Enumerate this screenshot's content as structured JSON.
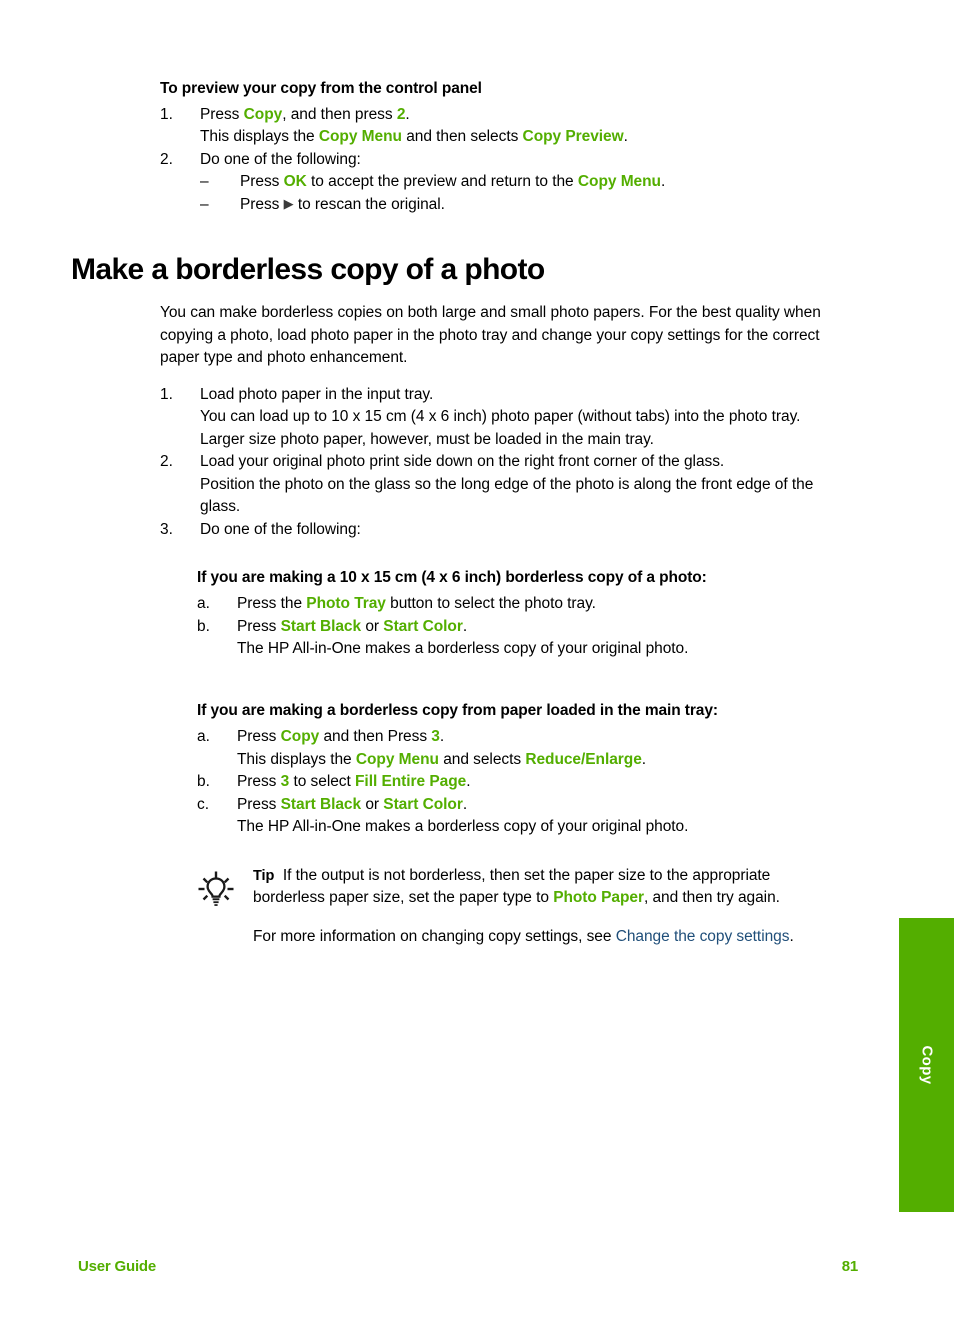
{
  "colors": {
    "accent_green": "#53ae00",
    "link_blue": "#1f4e79",
    "text_black": "#000000",
    "tab_white": "#ffffff"
  },
  "side_tab": {
    "label": "Copy"
  },
  "footer": {
    "left": "User Guide",
    "page_number": "81"
  },
  "preview_section": {
    "heading": "To preview your copy from the control panel",
    "step1": {
      "marker": "1.",
      "pre": "Press ",
      "b1": "Copy",
      "mid": ", and then press ",
      "b2": "2",
      "post": ".",
      "continuation": {
        "pre": "This displays the ",
        "b1": "Copy Menu",
        "mid": " and then selects ",
        "b2": "Copy Preview",
        "post": "."
      }
    },
    "step2": {
      "marker": "2.",
      "text": "Do one of the following:",
      "bullets": [
        {
          "marker": "–",
          "pre": "Press ",
          "b1": "OK",
          "mid": " to accept the preview and return to the ",
          "b2": "Copy Menu",
          "post": "."
        },
        {
          "marker": "–",
          "pre": "Press ",
          "icon": "▶",
          "post": " to rescan the original."
        }
      ]
    }
  },
  "main_section": {
    "title": "Make a borderless copy of a photo",
    "intro": "You can make borderless copies on both large and small photo papers. For the best quality when copying a photo, load photo paper in the photo tray and change your copy settings for the correct paper type and photo enhancement.",
    "steps": [
      {
        "marker": "1.",
        "text": "Load photo paper in the input tray.",
        "continuation": "You can load up to 10 x 15 cm (4 x 6 inch) photo paper (without tabs) into the photo tray. Larger size photo paper, however, must be loaded in the main tray."
      },
      {
        "marker": "2.",
        "text": "Load your original photo print side down on the right front corner of the glass.",
        "continuation": "Position the photo on the glass so the long edge of the photo is along the front edge of the glass."
      },
      {
        "marker": "3.",
        "text": "Do one of the following:"
      }
    ]
  },
  "subsection_a": {
    "heading": "If you are making a 10 x 15 cm (4 x 6 inch) borderless copy of a photo:",
    "items": [
      {
        "marker": "a.",
        "pre": "Press the ",
        "b1": "Photo Tray",
        "post": " button to select the photo tray."
      },
      {
        "marker": "b.",
        "pre": "Press ",
        "b1": "Start Black",
        "mid": " or ",
        "b2": "Start Color",
        "post": "."
      }
    ],
    "result": "The HP All-in-One makes a borderless copy of your original photo."
  },
  "subsection_b": {
    "heading": "If you are making a borderless copy from paper loaded in the main tray:",
    "items": [
      {
        "marker": "a.",
        "pre": "Press ",
        "b1": "Copy",
        "mid": " and then Press ",
        "b2": "3",
        "post": ".",
        "continuation": {
          "pre": "This displays the ",
          "b1": "Copy Menu",
          "mid": " and selects ",
          "b2": "Reduce/Enlarge",
          "post": "."
        }
      },
      {
        "marker": "b.",
        "pre": "Press ",
        "b1": "3",
        "mid": " to select ",
        "b2": "Fill Entire Page",
        "post": "."
      },
      {
        "marker": "c.",
        "pre": "Press ",
        "b1": "Start Black",
        "mid": " or ",
        "b2": "Start Color",
        "post": "."
      }
    ],
    "result": "The HP All-in-One makes a borderless copy of your original photo."
  },
  "tip": {
    "icon_name": "lightbulb-icon",
    "label": "Tip",
    "pre": "If the output is not borderless, then set the paper size to the appropriate borderless paper size, set the paper type to ",
    "b1": "Photo Paper",
    "post": ", and then try again.",
    "more_pre": "For more information on changing copy settings, see ",
    "more_link": "Change the copy settings",
    "more_post": "."
  }
}
